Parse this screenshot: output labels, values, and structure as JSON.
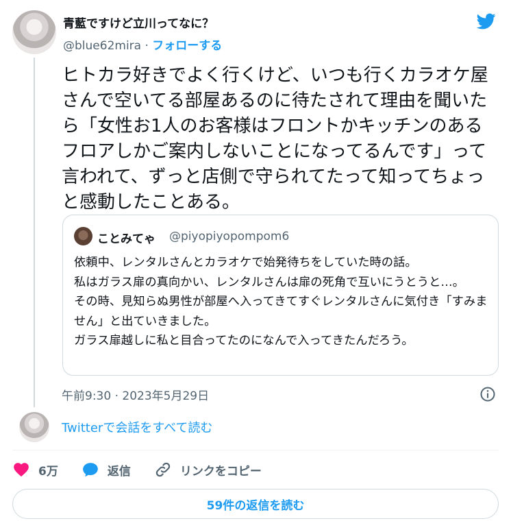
{
  "author": {
    "display_name": "青藍ですけど立川ってなに？",
    "handle": "@blue62mira",
    "separator": "·",
    "follow_label": "フォローする"
  },
  "tweet": {
    "text": "ヒトカラ好きでよく行くけど、いつも行くカラオケ屋さんで空いてる部屋あるのに待たされて理由を聞いたら「女性お1人のお客様はフロントかキッチンのあるフロアしかご案内しないことになってるんです」って言われて、ずっと店側で守られてたって知ってちょっと感動したことある。",
    "timestamp": "午前9:30 · 2023年5月29日"
  },
  "quoted_tweet": {
    "display_name": "ことみてゃ",
    "handle": "@piyopiyopompom6",
    "lines": [
      "依頼中、レンタルさんとカラオケで始発待ちをしていた時の話。",
      "私はガラス扉の真向かい、レンタルさんは扉の死角で互いにうとうと…。",
      "その時、見知らぬ男性が部屋へ入ってきてすぐレンタルさんに気付き「すみません」と出ていきました。",
      "ガラス扉越しに私と目合ってたのになんで入ってきたんだろう。"
    ]
  },
  "read_conversation_label": "Twitterで会話をすべて読む",
  "actions": {
    "like_count": "6万",
    "reply_label": "返信",
    "copy_link_label": "リンクをコピー"
  },
  "replies_button_label": "59件の返信を読む",
  "colors": {
    "accent": "#1d9bf0",
    "like": "#f91880",
    "text": "#0f1419",
    "secondary": "#536471",
    "border": "#cfd9de"
  },
  "icons": [
    "twitter-logo-icon",
    "info-icon",
    "heart-icon",
    "reply-bubble-icon",
    "link-icon"
  ]
}
